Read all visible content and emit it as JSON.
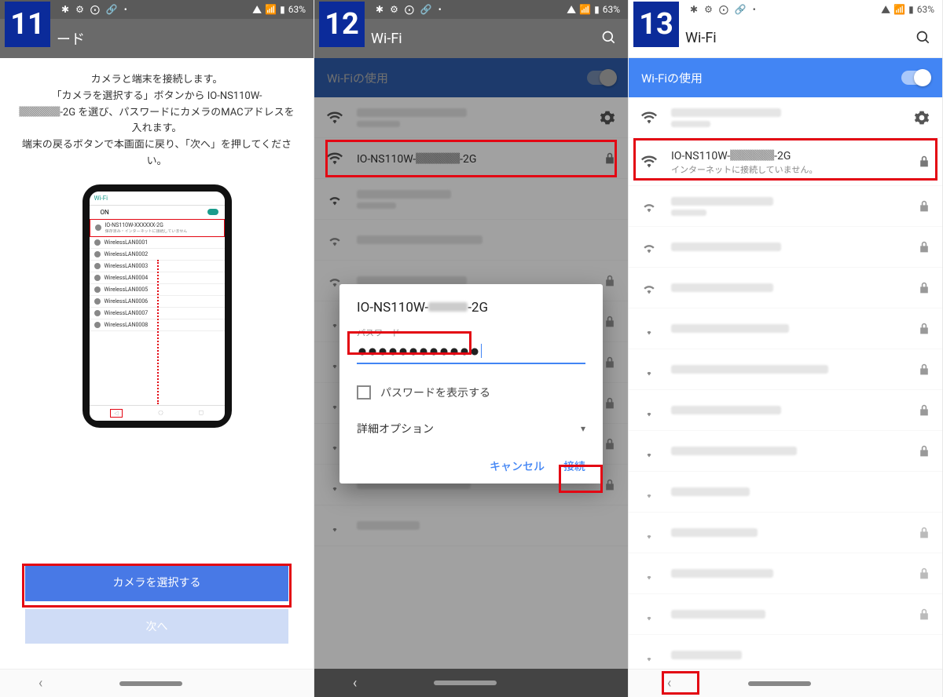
{
  "status": {
    "time": "",
    "battery": "63%",
    "icons_left": "✱ ⚙ ⨀ 🔗 •"
  },
  "steps": {
    "s11": "11",
    "s12": "12",
    "s13": "13"
  },
  "frame1": {
    "title": "ード",
    "instruction": "カメラと端末を接続します。\n「カメラを選択する」ボタンから IO-NS110W-\n▓▓▓▓-2G を選び、パスワードにカメラのMACアドレスを入れます。\n端末の戻るボタンで本画面に戻り、「次へ」を押してください。",
    "mock": {
      "wifi_label": "Wi-Fi",
      "on_label": "ON",
      "target_ssid": "IO-NS110W-XXXXXX-2G",
      "target_sub": "保存済み・インターネットに接続していません",
      "items": [
        "WirelessLAN0001",
        "WirelessLAN0002",
        "WirelessLAN0003",
        "WirelessLAN0004",
        "WirelessLAN0005",
        "WirelessLAN0006",
        "WirelessLAN0007",
        "WirelessLAN0008"
      ]
    },
    "btn_select": "カメラを選択する",
    "btn_next": "次へ"
  },
  "frame2": {
    "title": "Wi-Fi",
    "use_label": "Wi-Fiの使用",
    "target_ssid": "IO-NS110W-▓▓▓▓-2G",
    "dialog": {
      "title_prefix": "IO-NS110W-",
      "title_suffix": "-2G",
      "pw_label": "パスワード",
      "pw_dots": "●●●●●●●●●●●●",
      "show_pw": "パスワードを表示する",
      "advanced": "詳細オプション",
      "cancel": "キャンセル",
      "connect": "接続"
    }
  },
  "frame3": {
    "title": "Wi-Fi",
    "use_label": "Wi-Fiの使用",
    "target_ssid": "IO-NS110W-▓▓▓▓-2G",
    "target_sub": "インターネットに接続していません。"
  }
}
